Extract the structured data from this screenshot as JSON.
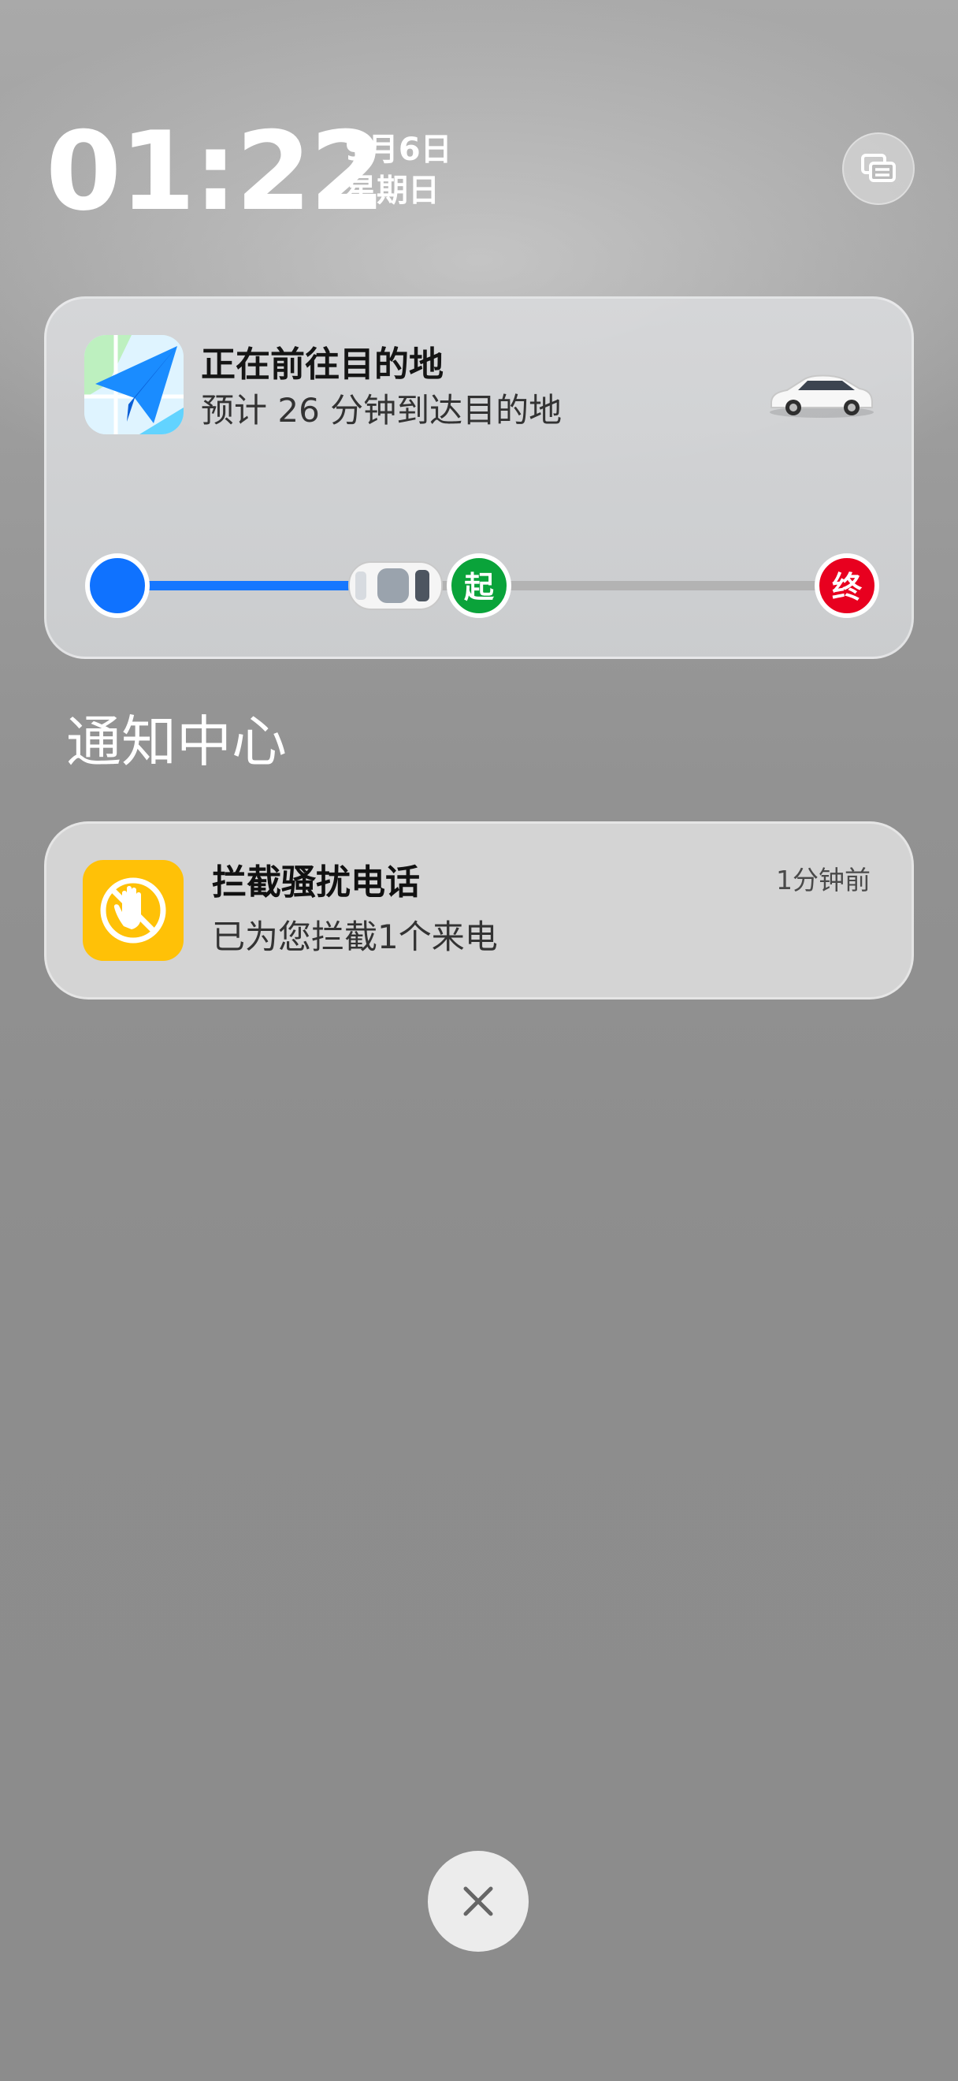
{
  "status": {
    "time": "01:22",
    "date": "9月6日",
    "weekday": "星期日"
  },
  "top_button": {
    "icon": "notification-stack-icon"
  },
  "navigation_card": {
    "app_icon": "navigation-paper-plane-icon",
    "title": "正在前往目的地",
    "subtitle": "预计 26 分钟到达目的地",
    "car_icon": "white-car-icon",
    "route": {
      "start_marker": "起",
      "end_marker": "终",
      "progress_to_start": 0.55,
      "colors": {
        "traveled": "#1677ff",
        "remaining": "#b3b3b3",
        "start": "#0aa33a",
        "end": "#e8001f"
      }
    }
  },
  "notification_center": {
    "title": "通知中心",
    "notifications": [
      {
        "icon": "block-hand-icon",
        "title": "拦截骚扰电话",
        "body": "已为您拦截1个来电",
        "time": "1分钟前",
        "icon_color": "#ffc107"
      }
    ]
  },
  "close_button": {
    "icon": "close-icon"
  }
}
